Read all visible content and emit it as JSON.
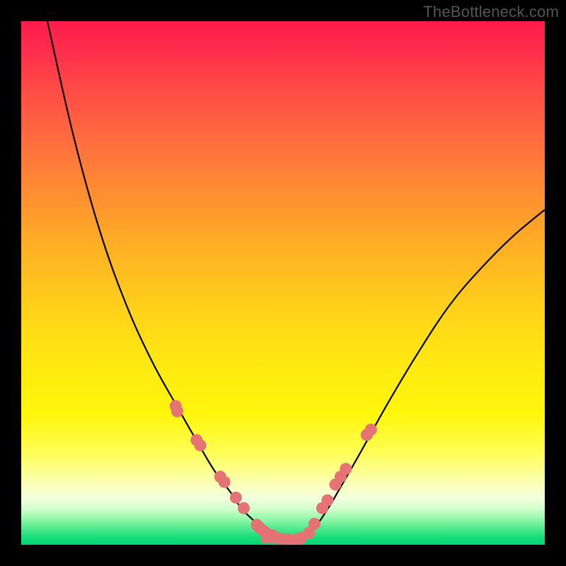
{
  "watermark": "TheBottleneck.com",
  "chart_data": {
    "type": "line",
    "title": "",
    "xlabel": "",
    "ylabel": "",
    "xlim": [
      0,
      100
    ],
    "ylim": [
      0,
      100
    ],
    "series": [
      {
        "name": "left-curve",
        "x": [
          5,
          10,
          15,
          20,
          25,
          30,
          34,
          37,
          40,
          42,
          44,
          46,
          48,
          50
        ],
        "values": [
          100,
          78,
          60,
          46,
          35,
          26,
          19,
          14,
          10,
          7,
          5,
          3,
          1.5,
          1
        ]
      },
      {
        "name": "right-curve",
        "x": [
          53,
          55,
          58,
          61,
          65,
          70,
          76,
          82,
          88,
          94,
          100
        ],
        "values": [
          1,
          2,
          6,
          11,
          18,
          27,
          37,
          46,
          53,
          59,
          64
        ]
      },
      {
        "name": "floor-segment",
        "x": [
          46.5,
          53
        ],
        "values": [
          1,
          1
        ]
      }
    ],
    "scatter": [
      {
        "name": "left-dots",
        "x": [
          29.5,
          29.8,
          33.5,
          34.2,
          38.0,
          38.8,
          41.0,
          42.5,
          45.0,
          45.6,
          46.5,
          48.0,
          49.5,
          51.0,
          52.5
        ],
        "values": [
          26.5,
          25.5,
          20.0,
          19.0,
          13.0,
          12.0,
          9.0,
          7.0,
          3.8,
          3.2,
          2.5,
          1.8,
          1.2,
          1.0,
          1.0
        ]
      },
      {
        "name": "right-dots",
        "x": [
          53.5,
          55.0,
          56.0,
          57.5,
          58.5,
          60.0,
          61.0,
          62.0,
          66.0,
          66.8
        ],
        "values": [
          1.3,
          2.3,
          4.0,
          7.0,
          8.5,
          11.5,
          13.0,
          14.5,
          21.0,
          22.0
        ]
      }
    ],
    "colors": {
      "curve": "#000000",
      "dots": "#e57373",
      "floor": "#e57373"
    }
  }
}
